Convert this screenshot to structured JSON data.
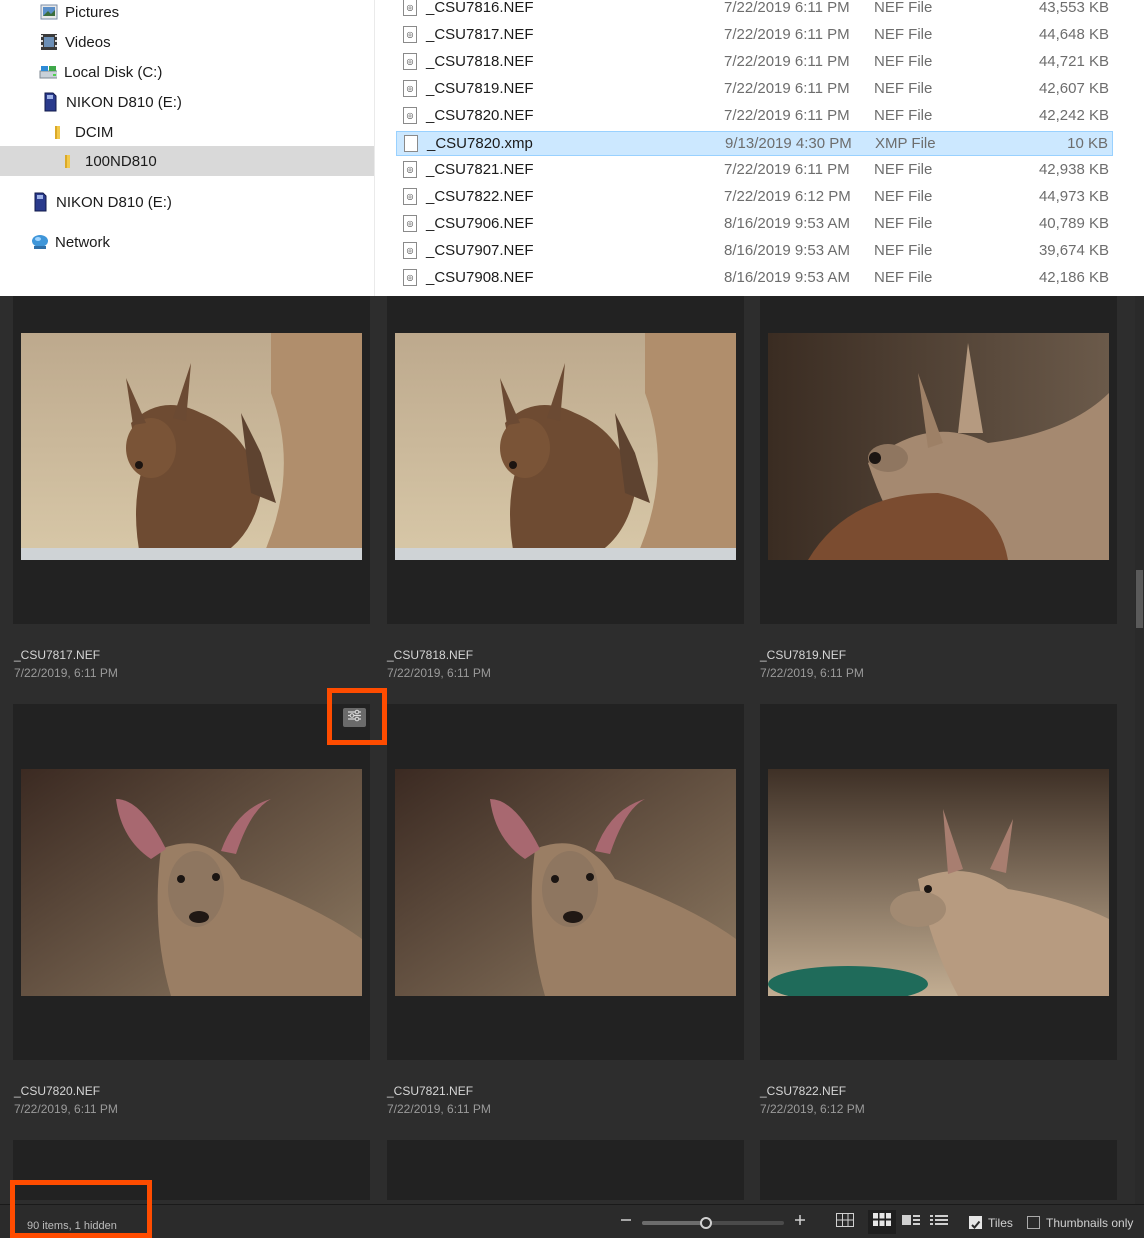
{
  "explorer": {
    "nav": [
      {
        "label": "Pictures",
        "icon": "pictures-folder-icon"
      },
      {
        "label": "Videos",
        "icon": "videos-folder-icon"
      },
      {
        "label": "Local Disk (C:)",
        "icon": "drive-icon"
      },
      {
        "label": "NIKON D810 (E:)",
        "icon": "sd-card-icon"
      },
      {
        "label": "DCIM",
        "icon": "folder-icon"
      },
      {
        "label": "100ND810",
        "icon": "folder-icon",
        "selected": true
      },
      {
        "label": "NIKON D810 (E:)",
        "icon": "sd-card-icon"
      },
      {
        "label": "Network",
        "icon": "network-icon"
      }
    ],
    "files": [
      {
        "name": "_CSU7816.NEF",
        "date": "7/22/2019 6:11 PM",
        "type": "NEF File",
        "size": "43,553 KB"
      },
      {
        "name": "_CSU7817.NEF",
        "date": "7/22/2019 6:11 PM",
        "type": "NEF File",
        "size": "44,648 KB"
      },
      {
        "name": "_CSU7818.NEF",
        "date": "7/22/2019 6:11 PM",
        "type": "NEF File",
        "size": "44,721 KB"
      },
      {
        "name": "_CSU7819.NEF",
        "date": "7/22/2019 6:11 PM",
        "type": "NEF File",
        "size": "42,607 KB"
      },
      {
        "name": "_CSU7820.NEF",
        "date": "7/22/2019 6:11 PM",
        "type": "NEF File",
        "size": "42,242 KB"
      },
      {
        "name": "_CSU7820.xmp",
        "date": "9/13/2019 4:30 PM",
        "type": "XMP File",
        "size": "10 KB",
        "selected": true
      },
      {
        "name": "_CSU7821.NEF",
        "date": "7/22/2019 6:11 PM",
        "type": "NEF File",
        "size": "42,938 KB"
      },
      {
        "name": "_CSU7822.NEF",
        "date": "7/22/2019 6:12 PM",
        "type": "NEF File",
        "size": "44,973 KB"
      },
      {
        "name": "_CSU7906.NEF",
        "date": "8/16/2019 9:53 AM",
        "type": "NEF File",
        "size": "40,789 KB"
      },
      {
        "name": "_CSU7907.NEF",
        "date": "8/16/2019 9:53 AM",
        "type": "NEF File",
        "size": "39,674 KB"
      },
      {
        "name": "_CSU7908.NEF",
        "date": "8/16/2019 9:53 AM",
        "type": "NEF File",
        "size": "42,186 KB"
      }
    ]
  },
  "browser": {
    "tiles": [
      {
        "name": "_CSU7817.NEF",
        "date": "7/22/2019, 6:11 PM"
      },
      {
        "name": "_CSU7818.NEF",
        "date": "7/22/2019, 6:11 PM"
      },
      {
        "name": "_CSU7819.NEF",
        "date": "7/22/2019, 6:11 PM"
      },
      {
        "name": "_CSU7820.NEF",
        "date": "7/22/2019, 6:11 PM"
      },
      {
        "name": "_CSU7821.NEF",
        "date": "7/22/2019, 6:11 PM"
      },
      {
        "name": "_CSU7822.NEF",
        "date": "7/22/2019, 6:12 PM"
      }
    ],
    "status": {
      "items_text": "90 items, 1 hidden",
      "zoom_level": 0.45,
      "tiles_label": "Tiles",
      "tiles_checked": true,
      "thumbnails_only_label": "Thumbnails only",
      "thumbnails_only_checked": false
    },
    "accent_highlight": "#ff4c00"
  }
}
